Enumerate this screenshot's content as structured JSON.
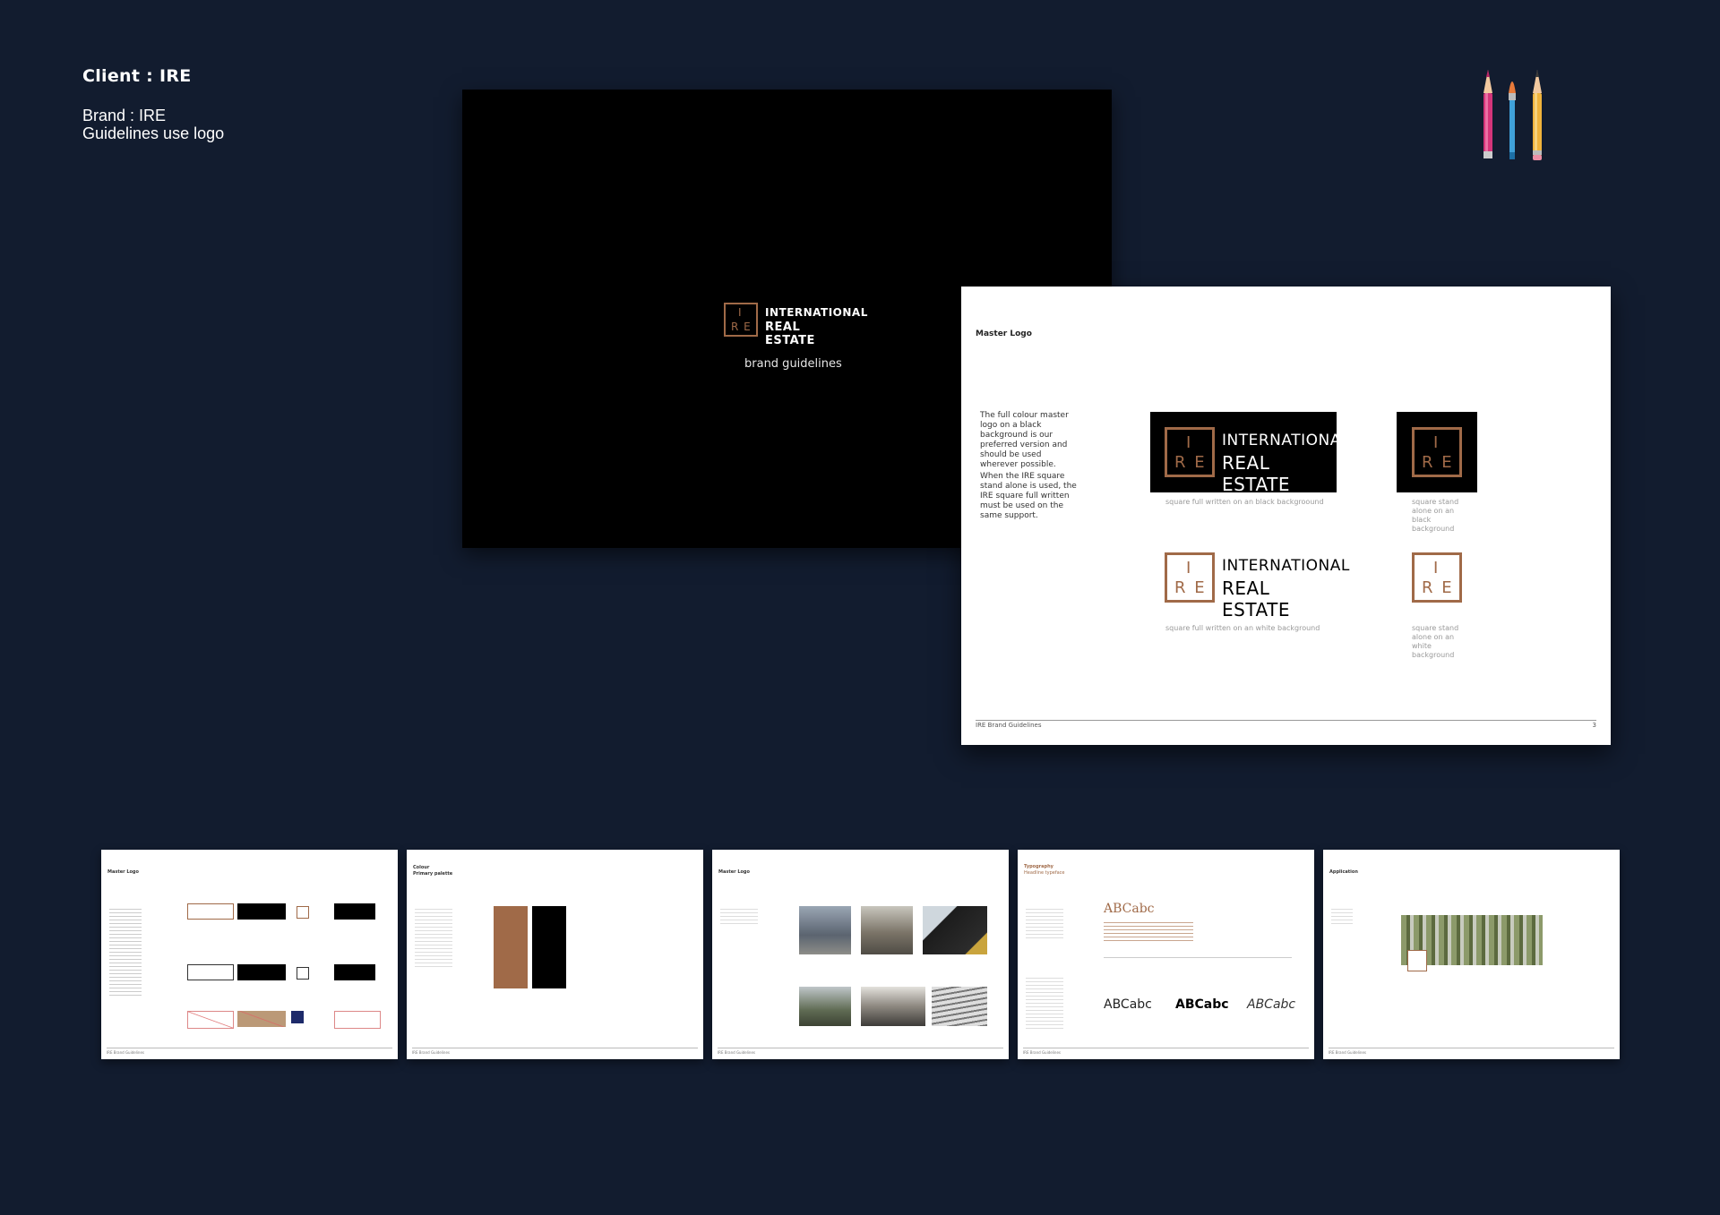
{
  "header": {
    "client": "Client : IRE",
    "brand": "Brand : IRE",
    "subtitle": "Guidelines use logo"
  },
  "colors": {
    "background": "#121c2f",
    "copper": "#a06a48",
    "black": "#000000",
    "white": "#ffffff"
  },
  "logo": {
    "mark_top": "I",
    "mark_bottom": "R E",
    "line1": "INTERNATIONAL",
    "line2": "REAL ESTATE"
  },
  "cover": {
    "subtitle": "brand guidelines"
  },
  "master_page": {
    "title": "Master Logo",
    "paragraph1": "The full colour master logo on a black background is our preferred version and should be used wherever possible.",
    "paragraph2": "When the IRE square stand alone is used, the IRE square full written must be used on the same support.",
    "caption_black_full": "square full written on an black backgroound",
    "caption_black_square": "square stand alone on an black background",
    "caption_white_full": "square full written on an white background",
    "caption_white_square": "square stand alone on an white background",
    "footer_left": "IRE Brand Guidelines",
    "footer_page": "3"
  },
  "thumbnails": [
    {
      "title": "Master Logo",
      "footer": "IRE Brand Guidelines"
    },
    {
      "title": "Colour",
      "subtitle": "Primary palette",
      "footer": "IRE Brand Guidelines"
    },
    {
      "title": "Master Logo",
      "footer": "IRE Brand Guidelines"
    },
    {
      "title": "Typography",
      "subtitle": "Headline typeface",
      "sample": "ABCabc",
      "footer": "IRE Brand Guidelines"
    },
    {
      "title": "Application",
      "footer": "IRE Brand Guidelines"
    }
  ],
  "typography_samples": [
    "ABCabc",
    "ABCabc",
    "ABCabc"
  ],
  "icons": [
    "pencil-pink-icon",
    "paintbrush-blue-icon",
    "pencil-yellow-icon"
  ]
}
